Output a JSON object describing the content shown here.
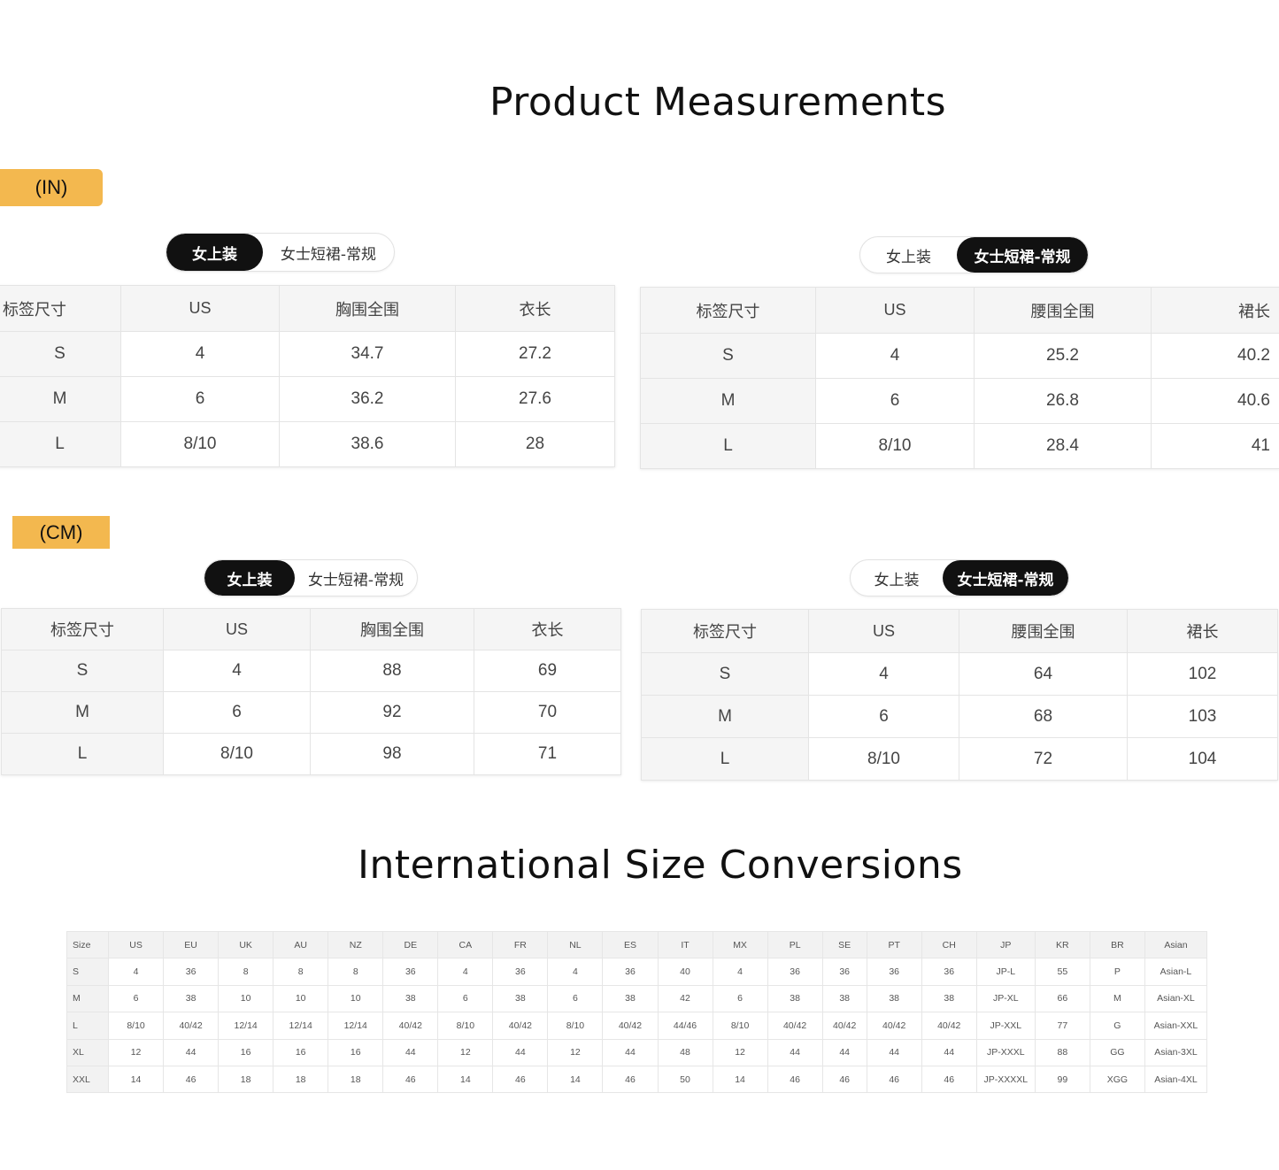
{
  "titles": {
    "product_measurements": "Product Measurements",
    "international_conversions": "International Size Conversions"
  },
  "units": {
    "inch": "(IN)",
    "cm": "(CM)"
  },
  "toggle": {
    "top": "女上装",
    "skirt": "女士短裙-常规"
  },
  "tables": {
    "in_top": {
      "headers": [
        "标签尺寸",
        "US",
        "胸围全围",
        "衣长"
      ],
      "rows": [
        [
          "S",
          "4",
          "34.7",
          "27.2"
        ],
        [
          "M",
          "6",
          "36.2",
          "27.6"
        ],
        [
          "L",
          "8/10",
          "38.6",
          "28"
        ]
      ]
    },
    "in_skirt": {
      "headers": [
        "标签尺寸",
        "US",
        "腰围全围",
        "裙长"
      ],
      "rows": [
        [
          "S",
          "4",
          "25.2",
          "40.2"
        ],
        [
          "M",
          "6",
          "26.8",
          "40.6"
        ],
        [
          "L",
          "8/10",
          "28.4",
          "41"
        ]
      ]
    },
    "cm_top": {
      "headers": [
        "标签尺寸",
        "US",
        "胸围全围",
        "衣长"
      ],
      "rows": [
        [
          "S",
          "4",
          "88",
          "69"
        ],
        [
          "M",
          "6",
          "92",
          "70"
        ],
        [
          "L",
          "8/10",
          "98",
          "71"
        ]
      ]
    },
    "cm_skirt": {
      "headers": [
        "标签尺寸",
        "US",
        "腰围全围",
        "裙长"
      ],
      "rows": [
        [
          "S",
          "4",
          "64",
          "102"
        ],
        [
          "M",
          "6",
          "68",
          "103"
        ],
        [
          "L",
          "8/10",
          "72",
          "104"
        ]
      ]
    }
  },
  "conversion": {
    "headers": [
      "Size",
      "US",
      "EU",
      "UK",
      "AU",
      "NZ",
      "DE",
      "CA",
      "FR",
      "NL",
      "ES",
      "IT",
      "MX",
      "PL",
      "SE",
      "PT",
      "CH",
      "JP",
      "KR",
      "BR",
      "Asian"
    ],
    "rows": [
      [
        "S",
        "4",
        "36",
        "8",
        "8",
        "8",
        "36",
        "4",
        "36",
        "4",
        "36",
        "40",
        "4",
        "36",
        "36",
        "36",
        "36",
        "JP-L",
        "55",
        "P",
        "Asian-L"
      ],
      [
        "M",
        "6",
        "38",
        "10",
        "10",
        "10",
        "38",
        "6",
        "38",
        "6",
        "38",
        "42",
        "6",
        "38",
        "38",
        "38",
        "38",
        "JP-XL",
        "66",
        "M",
        "Asian-XL"
      ],
      [
        "L",
        "8/10",
        "40/42",
        "12/14",
        "12/14",
        "12/14",
        "40/42",
        "8/10",
        "40/42",
        "8/10",
        "40/42",
        "44/46",
        "8/10",
        "40/42",
        "40/42",
        "40/42",
        "40/42",
        "JP-XXL",
        "77",
        "G",
        "Asian-XXL"
      ],
      [
        "XL",
        "12",
        "44",
        "16",
        "16",
        "16",
        "44",
        "12",
        "44",
        "12",
        "44",
        "48",
        "12",
        "44",
        "44",
        "44",
        "44",
        "JP-XXXL",
        "88",
        "GG",
        "Asian-3XL"
      ],
      [
        "XXL",
        "14",
        "46",
        "18",
        "18",
        "18",
        "46",
        "14",
        "46",
        "14",
        "46",
        "50",
        "14",
        "46",
        "46",
        "46",
        "46",
        "JP-XXXXL",
        "99",
        "XGG",
        "Asian-4XL"
      ]
    ]
  }
}
